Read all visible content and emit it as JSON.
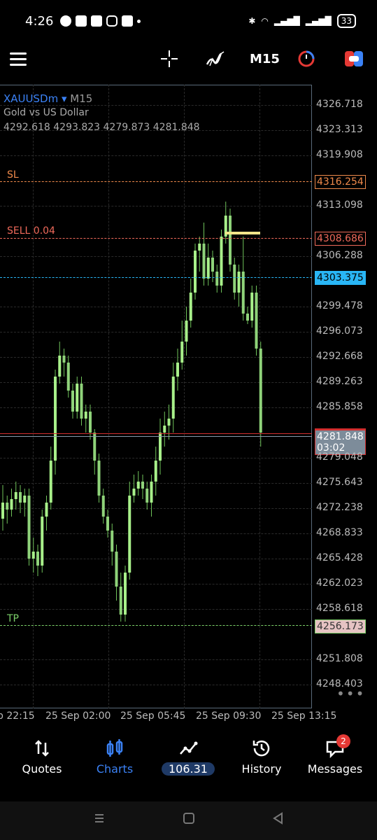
{
  "status": {
    "time": "4:26",
    "battery": "33"
  },
  "toolbar": {
    "timeframe": "M15"
  },
  "chart": {
    "symbol": "XAUUSDm",
    "tf": "M15",
    "description": "Gold vs US Dollar",
    "ohlc": "4292.618 4293.823 4279.873 4281.848",
    "price_axis": [
      "4326.718",
      "4323.313",
      "4319.908",
      "4313.098",
      "4306.288",
      "4299.478",
      "4296.073",
      "4292.668",
      "4289.263",
      "4285.858",
      "4279.048",
      "4275.643",
      "4272.238",
      "4268.833",
      "4265.428",
      "4262.023",
      "4258.618",
      "4251.808",
      "4248.403"
    ],
    "levels": {
      "sl": {
        "label": "SL",
        "price": "4316.254",
        "color": "#f08a4b"
      },
      "sell": {
        "label": "SELL 0.04",
        "price": "4308.686",
        "color": "#f06a5b"
      },
      "bid": {
        "price": "4303.375",
        "color": "#29b6f6"
      },
      "current": {
        "price": "4281.848",
        "countdown": "03:02",
        "color": "#d32f2f"
      },
      "tp": {
        "label": "TP",
        "price": "4256.173",
        "color": "#7cd16a"
      }
    },
    "time_axis": [
      "p 22:15",
      "25 Sep 02:00",
      "25 Sep 05:45",
      "25 Sep 09:30",
      "25 Sep 13:15"
    ],
    "more_icon": "ellipsis-icon"
  },
  "tabs": {
    "quotes": "Quotes",
    "charts": "Charts",
    "balance": "106.31",
    "history": "History",
    "messages": "Messages",
    "messages_badge": "2"
  },
  "icons": {
    "menu": "menu-icon",
    "crosshair": "crosshair-icon",
    "indicators": "indicators-icon",
    "clock": "clock-icon",
    "trade": "trade-icon"
  }
}
